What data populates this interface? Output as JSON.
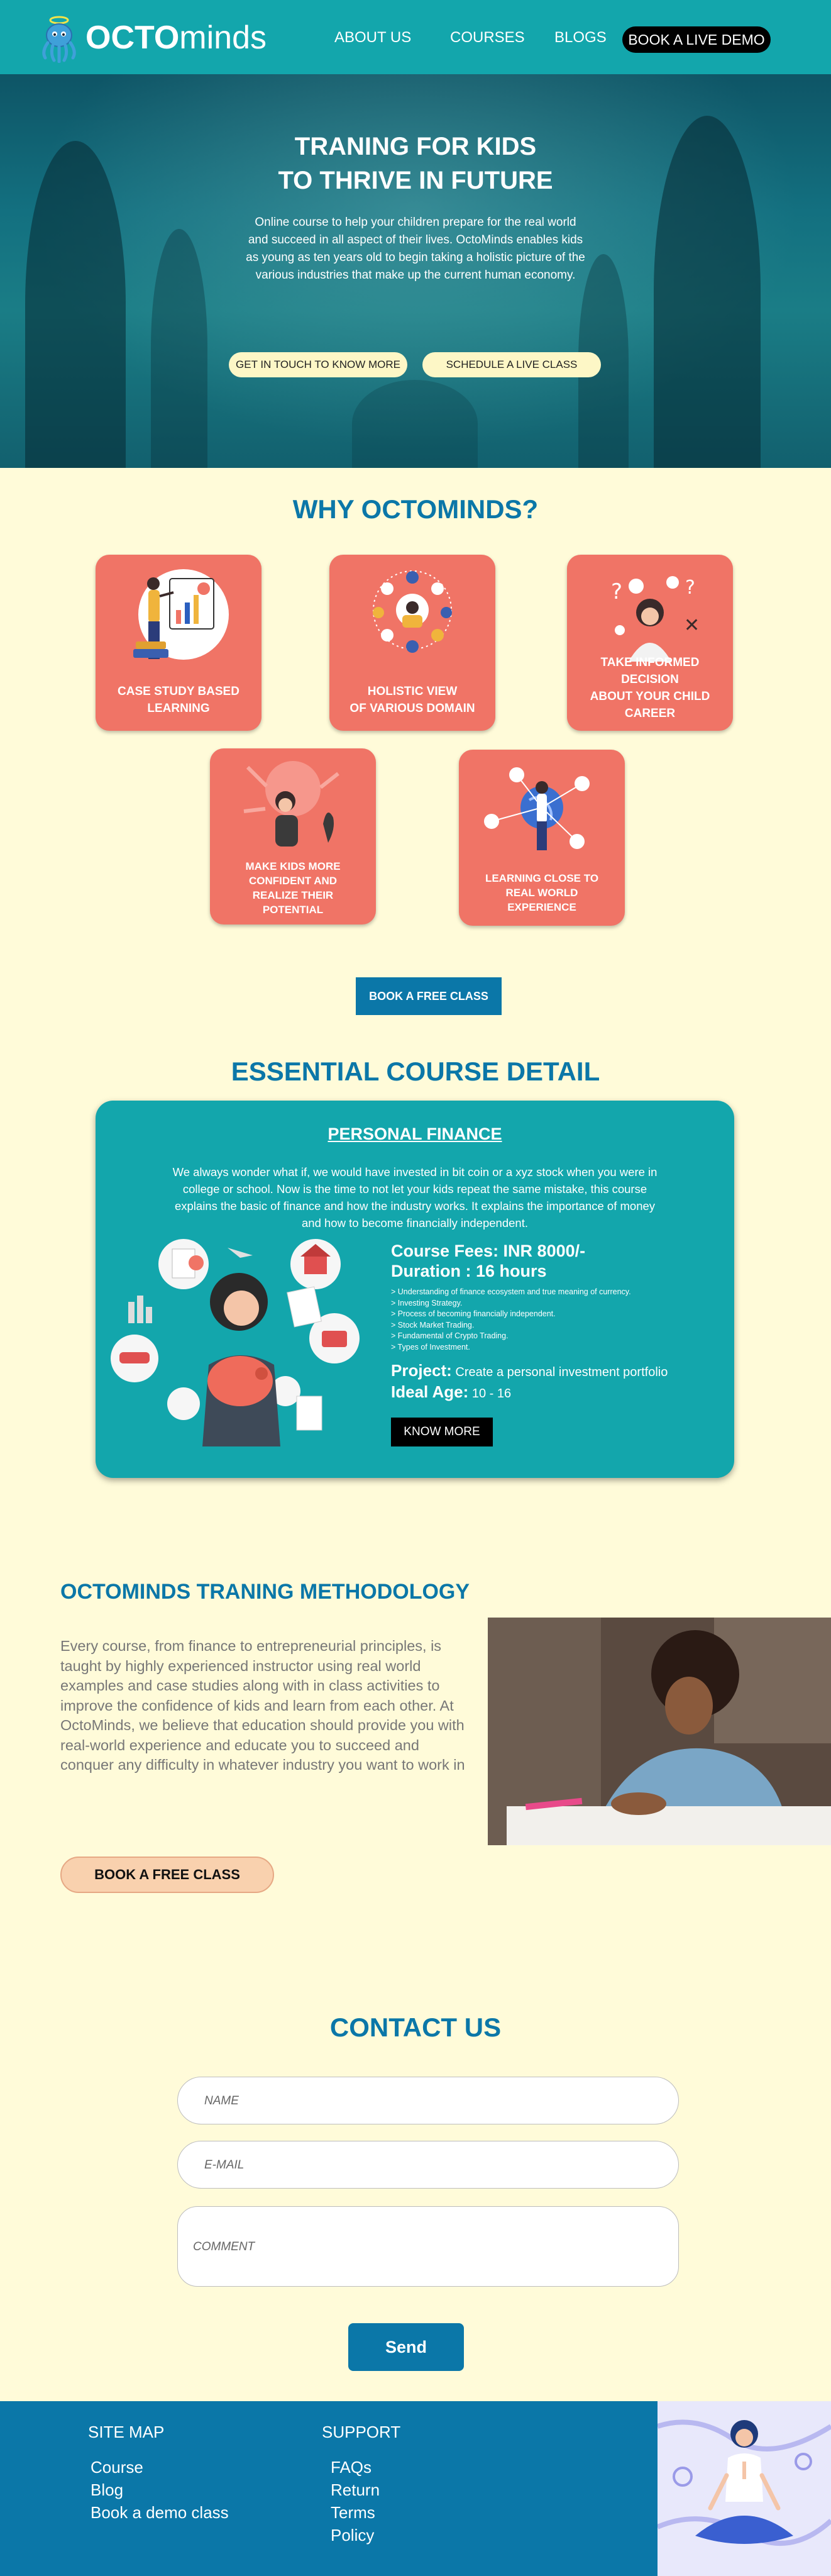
{
  "nav": {
    "logo_prefix": "OCTO",
    "logo_suffix": "minds",
    "links": [
      "ABOUT US",
      "COURSES",
      "BLOGS"
    ],
    "cta": "BOOK A LIVE DEMO"
  },
  "hero": {
    "title_line1": "TRANING FOR KIDS",
    "title_line2": "TO THRIVE IN FUTURE",
    "text": "Online course to help your children prepare for the real world and succeed in all aspect of their lives. OctoMinds enables kids as young as ten years old to begin taking a holistic picture of the various industries that make up the current human economy.",
    "btn_contact": "GET IN TOUCH TO KNOW MORE",
    "btn_schedule": "SCHEDULE A LIVE CLASS"
  },
  "why": {
    "title": "WHY OCTOMINDS?",
    "cards": [
      {
        "line1": "CASE STUDY BASED",
        "line2": "LEARNING",
        "line3": "",
        "line4": ""
      },
      {
        "line1": "HOLISTIC VIEW",
        "line2": "OF VARIOUS DOMAIN",
        "line3": "",
        "line4": ""
      },
      {
        "line1": "TAKE INFORMED DECISION",
        "line2": "ABOUT YOUR CHILD",
        "line3": "CAREER",
        "line4": ""
      },
      {
        "line1": "MAKE KIDS MORE",
        "line2": "CONFIDENT AND",
        "line3": "REALIZE THEIR",
        "line4": "POTENTIAL"
      },
      {
        "line1": "LEARNING CLOSE TO",
        "line2": "REAL WORLD",
        "line3": "EXPERIENCE",
        "line4": ""
      }
    ],
    "button": "BOOK A FREE CLASS"
  },
  "course": {
    "section_title": "ESSENTIAL COURSE DETAIL",
    "title": "PERSONAL FINANCE",
    "desc": "We always wonder what if, we would have invested in bit coin or a xyz stock when you were in college or school. Now is the time to not let your kids repeat the same mistake, this course explains the basic of finance and how the industry works. It explains the importance of money and how to become financially independent.",
    "fees": "Course Fees: INR 8000/-",
    "duration": "Duration : 16 hours",
    "bullets": [
      "> Understanding of finance ecosystem and true meaning of currency.",
      "> Investing Strategy.",
      "> Process of becoming financially independent.",
      "> Stock Market Trading.",
      "> Fundamental of Crypto Trading.",
      "> Types of Investment."
    ],
    "project_label": "Project:",
    "project_value": "Create a personal investment portfolio",
    "age_label": "Ideal Age:",
    "age_value": "10 - 16",
    "button": "KNOW MORE"
  },
  "methodology": {
    "title": "OCTOMINDS TRANING METHODOLOGY",
    "text": "Every course, from finance to entrepreneurial principles, is taught by highly experienced instructor using real world examples and case studies along with in class activities to improve the confidence of kids and learn from each other. At OctoMinds, we believe that education should provide you with real-world experience and educate you to succeed and conquer any difficulty in whatever industry you want to work in",
    "button": "BOOK A FREE CLASS"
  },
  "contact": {
    "title": "CONTACT US",
    "name_placeholder": "NAME",
    "email_placeholder": "E-MAIL",
    "comment_placeholder": "COMMENT",
    "send": "Send"
  },
  "footer": {
    "sitemap_title": "SITE MAP",
    "sitemap": [
      "Course",
      "Blog",
      "Book a demo class"
    ],
    "support_title": "SUPPORT",
    "support": [
      "FAQs",
      "Return",
      "Terms",
      "Policy"
    ]
  },
  "colors": {
    "nav": "#13a6ac",
    "accent_blue": "#0b77a8",
    "card_coral": "#f07466",
    "page_bg": "#fffbd9",
    "peach": "#f9d1ae"
  }
}
